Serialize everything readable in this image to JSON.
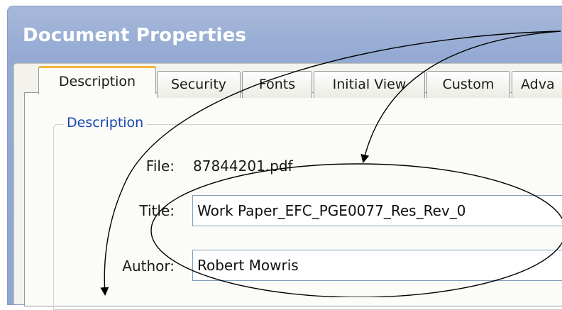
{
  "window": {
    "title": "Document Properties"
  },
  "tabs": [
    {
      "label": "Description",
      "active": true
    },
    {
      "label": "Security"
    },
    {
      "label": "Fonts"
    },
    {
      "label": "Initial View"
    },
    {
      "label": "Custom"
    },
    {
      "label": "Adva"
    }
  ],
  "description": {
    "group_label": "Description",
    "file_label": "File:",
    "file_value": "87844201.pdf",
    "title_label": "Title:",
    "title_value": "Work Paper_EFC_PGE0077_Res_Rev_0",
    "author_label": "Author:",
    "author_value": "Robert Mowris"
  },
  "colors": {
    "titlebar": "#94aad3",
    "active_tab_accent": "#f2b43a",
    "group_label": "#1846b3",
    "field_border": "#7f9db9"
  }
}
